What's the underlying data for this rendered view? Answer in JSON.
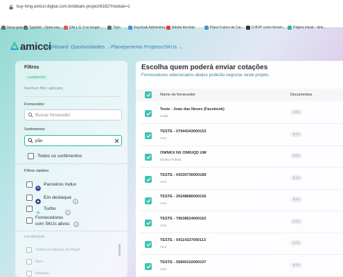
{
  "browser": {
    "url": "buy-hmg.amicci-digital.com.br/details-project/6182?module=1",
    "bookmarks": [
      {
        "label": "Nova guia",
        "color": "#6b6b6b"
      },
      {
        "label": "Typebot - Open-sou...",
        "color": "#6b6b6b"
      },
      {
        "label": "DALL·E 3 no longer...",
        "color": "#e05a5a"
      },
      {
        "label": "Typo",
        "color": "#6b6b6b"
      },
      {
        "label": "Keycloak Administra...",
        "color": "#4a90d9"
      },
      {
        "label": "Adobe Acrobat",
        "color": "#e04040"
      },
      {
        "label": "Plano Futuro de Car...",
        "color": "#4a90d9"
      },
      {
        "label": "O BVP como ferram...",
        "color": "#333333"
      },
      {
        "label": "Página inicial – Ami...",
        "color": "#2fb79e"
      }
    ]
  },
  "app": {
    "logo": "amicci",
    "accent": "#3fc3ad",
    "nav": [
      {
        "label": "Dashboard",
        "dropdown": false
      },
      {
        "label": "Oportunidades",
        "dropdown": true
      },
      {
        "label": "Planejamento",
        "dropdown": false
      },
      {
        "label": "Projetos",
        "dropdown": false
      },
      {
        "label": "SKUs",
        "dropdown": true
      }
    ]
  },
  "filters": {
    "title": "Filtros",
    "tag": "ALIMENTOS",
    "none_applied": "Nenhum filtro aplicado",
    "supplier_label": "Fornecedor",
    "supplier_placeholder": "Buscar fornecedor",
    "assortment_label": "Sortimentos",
    "assortment_value": "pão",
    "all_assortments": "Todos os sortimentos",
    "quick_label": "Filtros rápidos",
    "quick": [
      {
        "label": "Parceiros Indux",
        "icon": "partner-icon",
        "info": false
      },
      {
        "label": "Em destaque",
        "icon": "star-badge-icon",
        "info": true
      },
      {
        "label": "Turbo",
        "icon": "turbo-icon",
        "info": true
      },
      {
        "label": "Fornecedores com SKUs ativos",
        "icon": "",
        "info": true
      }
    ],
    "location_label": "Localização",
    "locations": [
      "Todos os estados do Brasil",
      "Acre",
      "Alagoas"
    ]
  },
  "main": {
    "title": "Escolha quem poderá enviar cotações",
    "subtitle": "Fornecedores selecionados abaixo poderão negociar neste projeto.",
    "col_name": "Nome do fornecedor",
    "col_docs": "Documentos",
    "rows": [
      {
        "name": "Teste - Joao das Neves (Facebook)",
        "state": "Goiás",
        "docs": "1 / 1"
      },
      {
        "name": "TESTE - 07944343000153",
        "state": "Acre",
        "docs": "1 / 1"
      },
      {
        "name": "OWNKX NX OIWUQD UW",
        "state": "Distrito Federal",
        "docs": "1 / 1"
      },
      {
        "name": "TESTE - 04330736000189",
        "state": "Acre",
        "docs": "1 / 1"
      },
      {
        "name": "TESTE - 25248686000165",
        "state": "Acre",
        "docs": "1 / 1"
      },
      {
        "name": "TESTE - 79638524000162",
        "state": "Acre",
        "docs": "1 / 1"
      },
      {
        "name": "TESTE - 54114327000113",
        "state": "Acre",
        "docs": "1 / 1"
      },
      {
        "name": "TESTE - 55840102000107",
        "state": "Acre",
        "docs": "1 / 1"
      }
    ]
  }
}
